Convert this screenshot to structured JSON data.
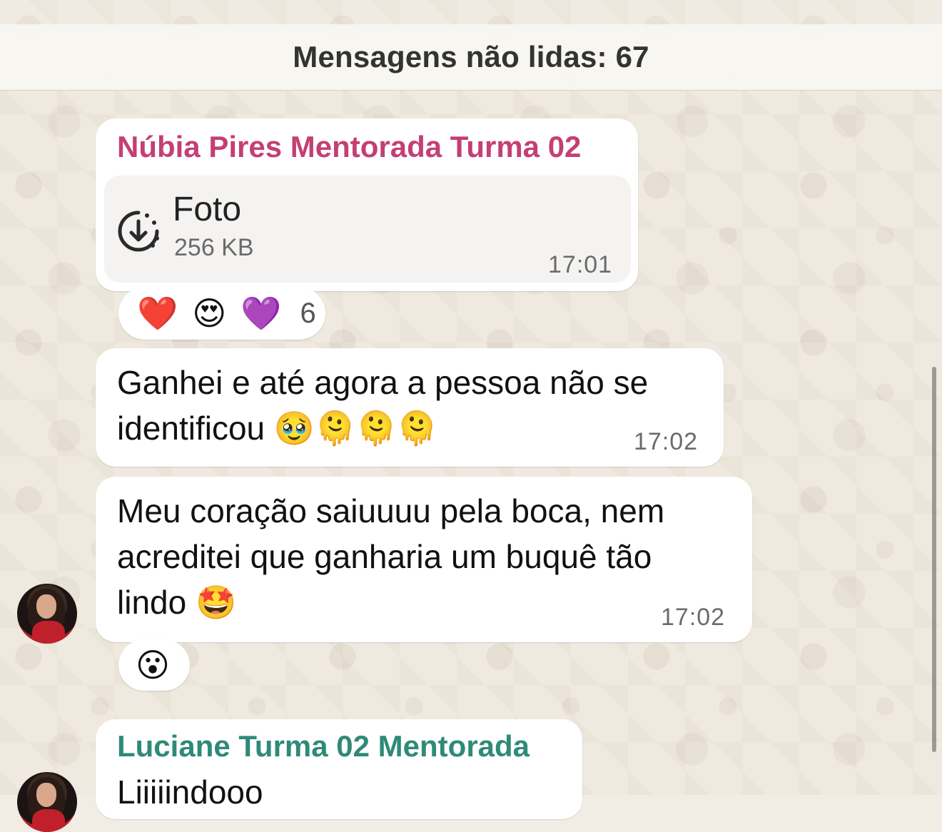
{
  "unread_banner": {
    "text": "Mensagens não lidas: 67"
  },
  "colors": {
    "sender_1": "#c43f74",
    "sender_2": "#2f8a78",
    "bubble_bg": "#ffffff",
    "banner_bg": "#f8f6f2",
    "wallpaper_bg": "#efe9df"
  },
  "messages": [
    {
      "sender": "Núbia Pires Mentorada Turma 02",
      "type": "file",
      "file": {
        "icon": "download-icon",
        "title": "Foto",
        "size": "256 KB"
      },
      "time": "17:01",
      "reactions": {
        "emojis": [
          "❤️",
          "😍",
          "💜"
        ],
        "count": "6"
      }
    },
    {
      "type": "text",
      "line1": "Ganhei e até agora a pessoa não se",
      "line2": "identificou 🥹🫠🫠🫠",
      "time": "17:02"
    },
    {
      "type": "text",
      "line1": "Meu coração saiuuuu pela boca, nem",
      "line2": "acreditei que ganharia um buquê tão",
      "line3": "lindo 🤩",
      "time": "17:02",
      "reactions": {
        "emojis": [
          "😮"
        ]
      }
    },
    {
      "sender": "Luciane Turma 02 Mentorada",
      "type": "text",
      "line1": "Liiiiindooo",
      "time": ""
    }
  ]
}
